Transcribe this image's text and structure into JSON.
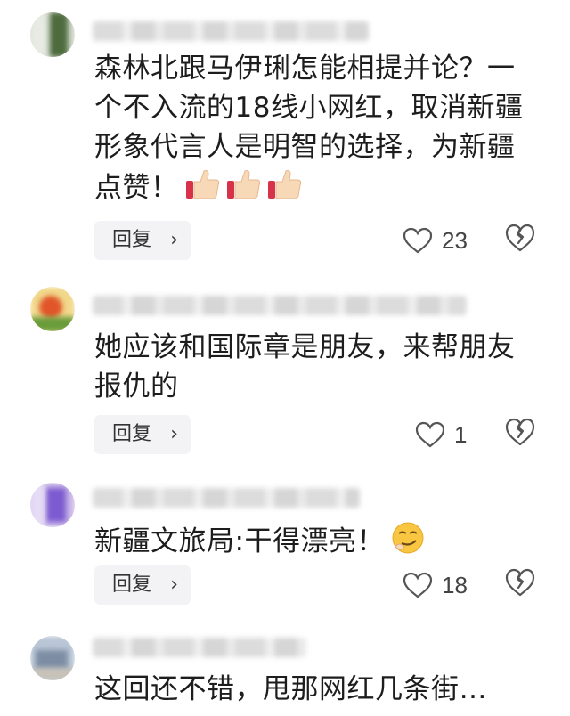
{
  "comments": [
    {
      "text_lines": [
        "森林北跟马伊琍怎能相提并论？一",
        "个不入流的18线小网红，取消新疆",
        "形象代言人是明智的选择，为新疆",
        "点赞！"
      ],
      "emoji": "thumbs-up x3",
      "reply_label": "回复",
      "likes": "23"
    },
    {
      "text_lines": [
        "她应该和国际章是朋友，来帮朋友",
        "报仇的"
      ],
      "reply_label": "回复",
      "likes": "1"
    },
    {
      "text_lines": [
        "新疆文旅局:干得漂亮！"
      ],
      "emoji": "smirk-face",
      "reply_label": "回复",
      "likes": "18"
    },
    {
      "text_lines": [
        "这回还不错，甩那网红几条街…"
      ]
    }
  ],
  "icons": {
    "like": "heart-icon",
    "dislike": "broken-heart-icon",
    "reply_chevron": "chevron-right-icon"
  },
  "colors": {
    "reply_bg": "#f3f3f5",
    "text": "#1d1d1d",
    "icon": "#444444"
  }
}
